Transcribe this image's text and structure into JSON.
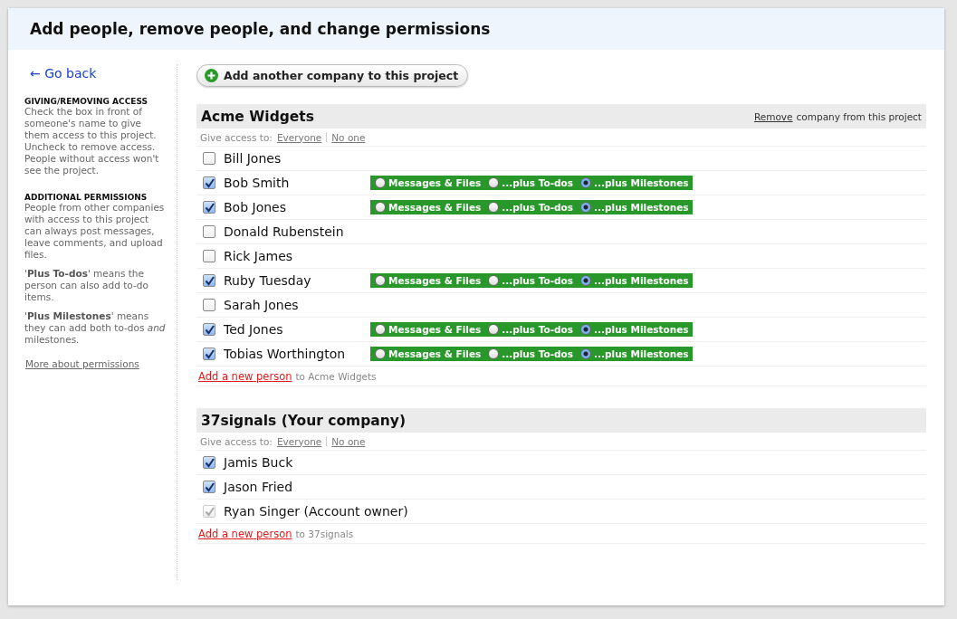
{
  "header": {
    "title": "Add people, remove people, and change permissions"
  },
  "sidebar": {
    "back_link": "← Go back",
    "sections": [
      {
        "heading": "GIVING/REMOVING ACCESS",
        "paragraphs": [
          "Check the box in front of someone's name to give them access to this project. Uncheck to remove access. People without access won't see the project."
        ]
      },
      {
        "heading": "ADDITIONAL PERMISSIONS",
        "paragraphs": [
          "People from other companies with access to this project can always post messages, leave comments, and upload files.",
          "'**Plus To-dos**' means the person can also add to-do items.",
          "'**Plus Milestones**' means they can add both to-dos *and* milestones."
        ]
      }
    ],
    "more_link": "More about permissions"
  },
  "add_company_button": "Add another company to this project",
  "companies": [
    {
      "name": "Acme Widgets",
      "remove_link": "Remove",
      "remove_text": "company from this project",
      "give_access_label": "Give access to:",
      "everyone_link": "Everyone",
      "no_one_link": "No one",
      "add_person_link": "Add a new person",
      "add_person_text": "to Acme Widgets",
      "people": [
        {
          "name": "Bill Jones",
          "checked": false,
          "disabled": false
        },
        {
          "name": "Bob Smith",
          "checked": true,
          "disabled": false,
          "permissions": [
            {
              "label": "Messages & Files",
              "selected": false
            },
            {
              "label": "...plus To-dos",
              "selected": false
            },
            {
              "label": "...plus Milestones",
              "selected": true
            }
          ]
        },
        {
          "name": "Bob Jones",
          "checked": true,
          "disabled": false,
          "permissions": [
            {
              "label": "Messages & Files",
              "selected": false
            },
            {
              "label": "...plus To-dos",
              "selected": false
            },
            {
              "label": "...plus Milestones",
              "selected": true
            }
          ]
        },
        {
          "name": "Donald Rubenstein",
          "checked": false,
          "disabled": false
        },
        {
          "name": "Rick James",
          "checked": false,
          "disabled": false
        },
        {
          "name": "Ruby Tuesday",
          "checked": true,
          "disabled": false,
          "permissions": [
            {
              "label": "Messages & Files",
              "selected": false
            },
            {
              "label": "...plus To-dos",
              "selected": false
            },
            {
              "label": "...plus Milestones",
              "selected": true
            }
          ]
        },
        {
          "name": "Sarah Jones",
          "checked": false,
          "disabled": false
        },
        {
          "name": "Ted Jones",
          "checked": true,
          "disabled": false,
          "permissions": [
            {
              "label": "Messages & Files",
              "selected": false
            },
            {
              "label": "...plus To-dos",
              "selected": false
            },
            {
              "label": "...plus Milestones",
              "selected": true
            }
          ]
        },
        {
          "name": "Tobias Worthington",
          "checked": true,
          "disabled": false,
          "permissions": [
            {
              "label": "Messages & Files",
              "selected": false
            },
            {
              "label": "...plus To-dos",
              "selected": false
            },
            {
              "label": "...plus Milestones",
              "selected": true
            }
          ]
        }
      ]
    },
    {
      "name": "37signals (Your company)",
      "give_access_label": "Give access to:",
      "everyone_link": "Everyone",
      "no_one_link": "No one",
      "add_person_link": "Add a new person",
      "add_person_text": "to 37signals",
      "people": [
        {
          "name": "Jamis Buck",
          "checked": true,
          "disabled": false
        },
        {
          "name": "Jason Fried",
          "checked": true,
          "disabled": false
        },
        {
          "name": "Ryan Singer (Account owner)",
          "checked": true,
          "disabled": true
        }
      ]
    }
  ]
}
